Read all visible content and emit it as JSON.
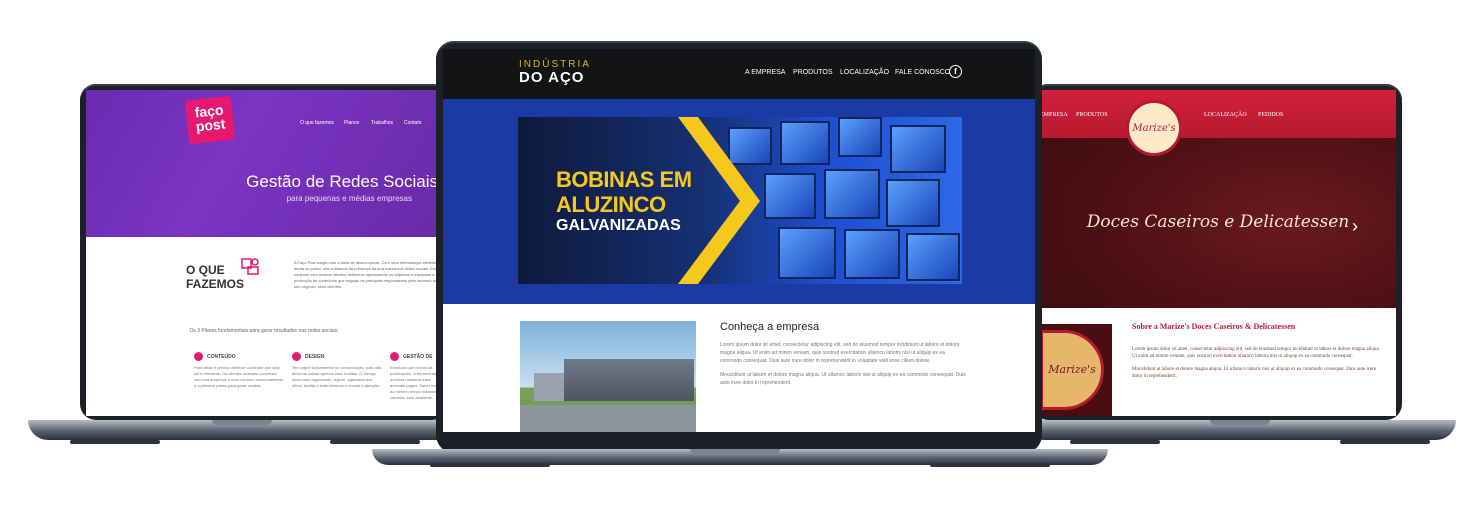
{
  "left_site": {
    "logo": "faço post",
    "nav": [
      "O que fazemos",
      "Planos",
      "Trabalhos",
      "Contato"
    ],
    "hero_title": "Gestão de Redes Sociais",
    "hero_subtitle": "para pequenas e médias empresas",
    "section_title_line1": "O QUE",
    "section_title_line2": "FAZEMOS",
    "section_text": "A Faço Post surgiu com a ideia de descomplicar. Com uma metodologia eficiente e direta ao ponto, nós cuidamos da presença da sua marca nos redes sociais. Em conjunto com nossos clientes definimos rapidamente os objetivos e iniciamos a promoção de conteúdos que engajar os principais responsáveis pelo sucesso do seu negócio, seus clientes.",
    "pillars_title": "Os 3 Pilares fundamentais para gerar resultados nas redes sociais:",
    "pillars": [
      {
        "title": "CONTEÚDO",
        "text": "Para atrair é preciso oferecer conteúdo que seja útil e relevante. Os clientes desejam conversar com sua empresa, e criar um bom relacionamento é o primeiro passo para gerar vendas."
      },
      {
        "title": "DESIGN",
        "text": "Tem papel fundamental na comunicação, pois não deixa as coisas apenas mais bonitas. O Design deixa tudo organizado, legível, agradável aos olhos, facilita o entendimento e chama a atenção."
      },
      {
        "title": "GESTÃO DE",
        "text": "Estrutura que mexos da publicações. A ferramenta próxima melhorar essa arsenais pages. Saber mais ao mesmo tempo maneira correcta. este ambiente."
      }
    ]
  },
  "center_site": {
    "brand_top": "INDÚSTRIA",
    "brand": "DO AÇO",
    "nav": [
      "A EMPRESA",
      "PRODUTOS",
      "LOCALIZAÇÃO",
      "FALE CONOSCO"
    ],
    "facebook_icon": "f",
    "banner_line1": "BOBINAS EM",
    "banner_line2": "ALUZINCO",
    "banner_line3": "GALVANIZADAS",
    "about_title": "Conheça a empresa",
    "about_p1": "Lorem ipsum dolor sit amet, consectetur adipiscing elit, sed do eiusmod tempor incididunt ut labore et dolore magna aliqua. Ut enim ad minim veniam, quis nostrud exercitation ullamco laboris nisi ut aliquip ex ea commodo consequat. Duis aute irure dolor in reprehenderit in voluptate velit esse cillum dolore.",
    "about_p2": "Mnociditunt ut labore et dolore magna aliqua. Ut ullamco laboris nisi ut aliquip ex ea commodo consequat. Duis aute irure dolor in reprehenderit."
  },
  "right_site": {
    "nav": [
      "EMPRESA",
      "PRODUTOS",
      "LOCALIZAÇÃO",
      "PEDIDOS"
    ],
    "logo": "Marize's",
    "hero_title": "Doces Caseiros e Delicatessen",
    "about_title": "Sobre a Marize's Doces Caseiros & Delicatessen",
    "about_p1": "Lorem ipsum dolor sit amet, consectetur adipiscing elit, sed do eiusmod tempor incididunt ut labore et dolore magna aliqua. Ut enim ad minim veniam, quis nostrud exercitation ullamco laboris nisi ut aliquip ex ea commodo consequat.",
    "about_p2": "Mncididunt ut labore et dolore magna aliqua. Ut ullamco laboris nisi ut aliquip ex ea commodo consequat. Duis aute irure dolor in reprehenderit."
  },
  "colors": {
    "faco_purple": "#7a35c2",
    "faco_pink": "#e6186f",
    "aco_blue": "#1b3aa6",
    "aco_yellow": "#f6c81c",
    "marize_red": "#b61a31"
  }
}
